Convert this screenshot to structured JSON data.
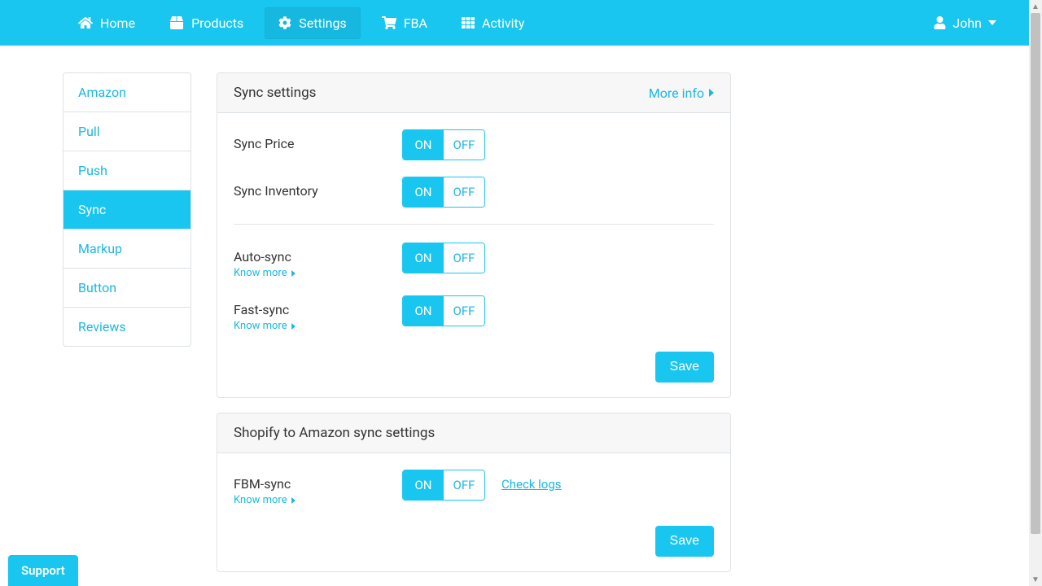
{
  "nav": {
    "items": [
      {
        "label": "Home",
        "icon": "home"
      },
      {
        "label": "Products",
        "icon": "box"
      },
      {
        "label": "Settings",
        "icon": "gear",
        "active": true
      },
      {
        "label": "FBA",
        "icon": "cart"
      },
      {
        "label": "Activity",
        "icon": "list"
      }
    ],
    "user": "John"
  },
  "sidebar": {
    "items": [
      {
        "label": "Amazon"
      },
      {
        "label": "Pull"
      },
      {
        "label": "Push"
      },
      {
        "label": "Sync",
        "active": true
      },
      {
        "label": "Markup"
      },
      {
        "label": "Button"
      },
      {
        "label": "Reviews"
      }
    ]
  },
  "panel1": {
    "title": "Sync settings",
    "more_info": "More info",
    "rows": {
      "sync_price": {
        "label": "Sync Price"
      },
      "sync_inventory": {
        "label": "Sync Inventory"
      },
      "auto_sync": {
        "label": "Auto-sync",
        "know_more": "Know more"
      },
      "fast_sync": {
        "label": "Fast-sync",
        "know_more": "Know more"
      }
    },
    "save": "Save"
  },
  "panel2": {
    "title": "Shopify to Amazon sync settings",
    "rows": {
      "fbm_sync": {
        "label": "FBM-sync",
        "know_more": "Know more",
        "check_logs": "Check logs"
      }
    },
    "save": "Save"
  },
  "toggle": {
    "on": "ON",
    "off": "OFF"
  },
  "support": "Support"
}
